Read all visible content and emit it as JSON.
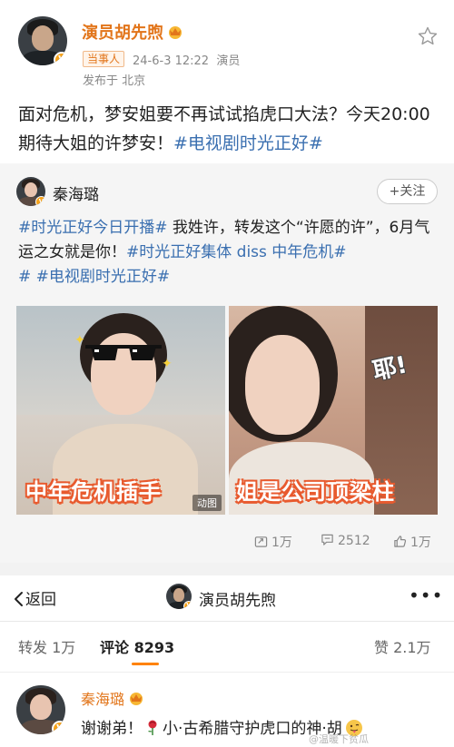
{
  "post": {
    "author": "演员胡先煦",
    "tag": "当事人",
    "datetime": "24-6-3 12:22",
    "role": "演员",
    "location": "发布于 北京",
    "text_plain": "面对危机，梦安姐要不再试试掐虎口大法？今天20:00期待大姐的许梦安！",
    "text_topic": "#电视剧时光正好#"
  },
  "repost": {
    "author": "秦海璐",
    "follow_label": "+关注",
    "topic1": "#时光正好今日开播#",
    "text1": " 我姓许，转发这个“许愿的许”，6月气运之女就是你！",
    "topic2": "#时光正好集体 diss 中年危机#",
    "topic3": " #电视剧时光正好#",
    "media": [
      {
        "caption": "中年危机插手",
        "badge": "动图"
      },
      {
        "caption": "姐是公司顶梁柱",
        "sticker": "耶!"
      }
    ],
    "stats": {
      "reposts": "1万",
      "comments": "2512",
      "likes": "1万"
    }
  },
  "nav": {
    "back_label": "返回",
    "title": "演员胡先煦",
    "more": "•••"
  },
  "tabs": {
    "repost_label": "转发",
    "repost_count": "1万",
    "comment_label": "评论",
    "comment_count": "8293",
    "like_label": "赞",
    "like_count": "2.1万"
  },
  "comment": {
    "author": "秦海璐",
    "text_before": "谢谢弟！",
    "text_after": "小·古希腊守护虎口的神·胡"
  },
  "watermark": "@温暖下贫瓜",
  "colors": {
    "accent_orange": "#e2751a",
    "topic_blue": "#3a6fb0",
    "tab_underline": "#ff8200",
    "caption_outline": "#e85a2e"
  },
  "icons": [
    "star-icon",
    "crown-icon",
    "repost-icon",
    "comment-icon",
    "like-icon",
    "back-chevron-icon",
    "rose-icon",
    "tongue-emoji-icon",
    "verified-badge-icon"
  ]
}
